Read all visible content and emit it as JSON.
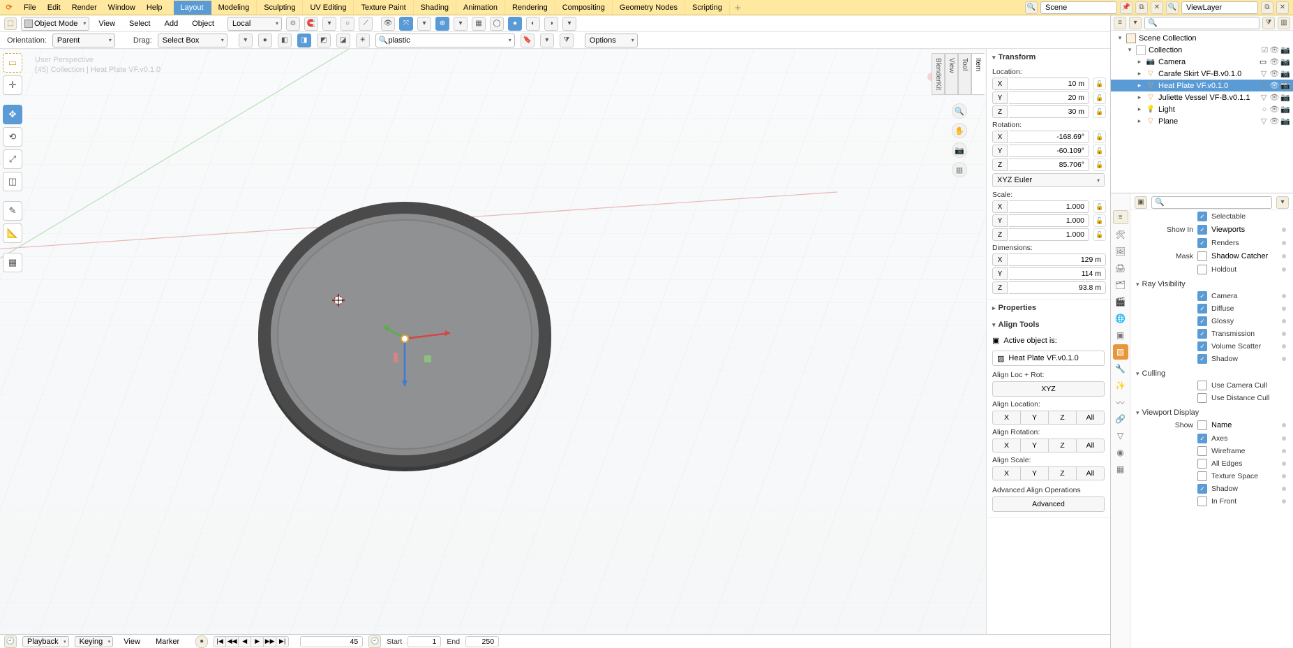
{
  "menus": {
    "file": "File",
    "edit": "Edit",
    "render": "Render",
    "window": "Window",
    "help": "Help"
  },
  "workspaces": [
    "Layout",
    "Modeling",
    "Sculpting",
    "UV Editing",
    "Texture Paint",
    "Shading",
    "Animation",
    "Rendering",
    "Compositing",
    "Geometry Nodes",
    "Scripting"
  ],
  "active_workspace": "Layout",
  "scene_label": "Scene",
  "viewlayer_label": "ViewLayer",
  "view_header": {
    "mode": "Object Mode",
    "menu_view": "View",
    "menu_select": "Select",
    "menu_add": "Add",
    "menu_object": "Object",
    "orient": "Local",
    "search_value": "plastic"
  },
  "sub_header": {
    "orientation_label": "Orientation:",
    "orientation_value": "Parent",
    "drag_label": "Drag:",
    "drag_value": "Select Box",
    "options_label": "Options"
  },
  "overlay": {
    "line1": "User Perspective",
    "line2": "(45) Collection | Heat Plate VF.v0.1.0"
  },
  "npanel": {
    "tabs": [
      "Item",
      "Tool",
      "View",
      "BlenderKit"
    ],
    "transform_title": "Transform",
    "location_title": "Location:",
    "loc": {
      "x": "10 m",
      "y": "20 m",
      "z": "30 m"
    },
    "rotation_title": "Rotation:",
    "rot": {
      "x": "-168.69°",
      "y": "-60.109°",
      "z": "85.706°"
    },
    "rot_mode": "XYZ Euler",
    "scale_title": "Scale:",
    "scale": {
      "x": "1.000",
      "y": "1.000",
      "z": "1.000"
    },
    "dim_title": "Dimensions:",
    "dim": {
      "x": "129 m",
      "y": "114 m",
      "z": "93.8 m"
    },
    "properties_title": "Properties",
    "align_title": "Align Tools",
    "active_label": "Active object is:",
    "active_object": "Heat Plate VF.v0.1.0",
    "align_locrot": "Align Loc + Rot:",
    "xyz_btn": "XYZ",
    "align_location": "Align Location:",
    "align_rotation": "Align Rotation:",
    "align_scale": "Align Scale:",
    "btns": {
      "x": "X",
      "y": "Y",
      "z": "Z",
      "all": "All"
    },
    "adv_title": "Advanced Align Operations",
    "adv_btn": "Advanced"
  },
  "outliner": {
    "root": "Scene Collection",
    "collection": "Collection",
    "items": [
      {
        "name": "Camera",
        "type": "camera"
      },
      {
        "name": "Carafe Skirt VF-B.v0.1.0",
        "type": "mesh"
      },
      {
        "name": "Heat Plate VF.v0.1.0",
        "type": "mesh",
        "selected": true
      },
      {
        "name": "Juliette Vessel VF-B.v0.1.1",
        "type": "mesh"
      },
      {
        "name": "Light",
        "type": "light"
      },
      {
        "name": "Plane",
        "type": "mesh"
      }
    ]
  },
  "props": {
    "selectable": "Selectable",
    "show_in": "Show In",
    "viewports": "Viewports",
    "renders": "Renders",
    "mask": "Mask",
    "shadow_catcher": "Shadow Catcher",
    "holdout": "Holdout",
    "ray_title": "Ray Visibility",
    "ray_items": [
      "Camera",
      "Diffuse",
      "Glossy",
      "Transmission",
      "Volume Scatter",
      "Shadow"
    ],
    "culling_title": "Culling",
    "use_camera_cull": "Use Camera Cull",
    "use_distance_cull": "Use Distance Cull",
    "vp_display_title": "Viewport Display",
    "show_label": "Show",
    "vp_items": [
      {
        "label": "Name",
        "on": false
      },
      {
        "label": "Axes",
        "on": true
      },
      {
        "label": "Wireframe",
        "on": false
      },
      {
        "label": "All Edges",
        "on": false
      },
      {
        "label": "Texture Space",
        "on": false
      },
      {
        "label": "Shadow",
        "on": true
      },
      {
        "label": "In Front",
        "on": false
      }
    ]
  },
  "timeline": {
    "playback": "Playback",
    "keying": "Keying",
    "view": "View",
    "marker": "Marker",
    "current": "45",
    "start_label": "Start",
    "start": "1",
    "end_label": "End",
    "end": "250"
  }
}
